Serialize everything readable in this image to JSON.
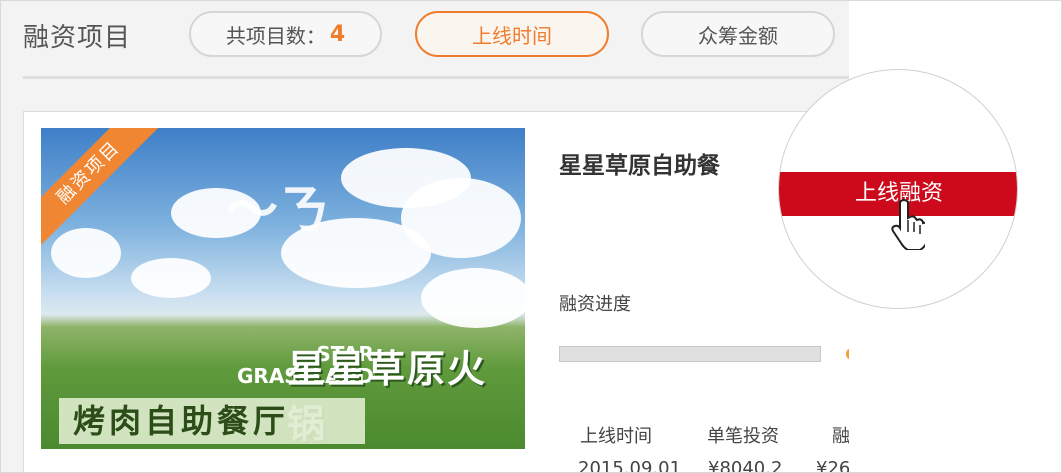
{
  "header": {
    "title": "融资项目",
    "count_label": "共项目数：",
    "count_value": "4",
    "sort_online_label": "上线时间",
    "sort_amount_label": "众筹金额"
  },
  "project": {
    "ribbon": "融资项目",
    "image_text_star": "STAR",
    "image_text_grassland": "GRASSLAND",
    "image_text_name": "星星草原火锅",
    "image_text_hall": "烤肉自助餐厅",
    "name": "星星草原自助餐",
    "progress_label": "融资进度",
    "progress": 0,
    "columns": [
      "上线时间",
      "单笔投资",
      "融"
    ],
    "values": [
      "2015.09.01",
      "¥8040.2",
      "¥26"
    ]
  },
  "callout": {
    "button_label": "上线融资"
  },
  "colors": {
    "accent_orange": "#ef7d2d",
    "button_red": "#cc0a1c"
  }
}
